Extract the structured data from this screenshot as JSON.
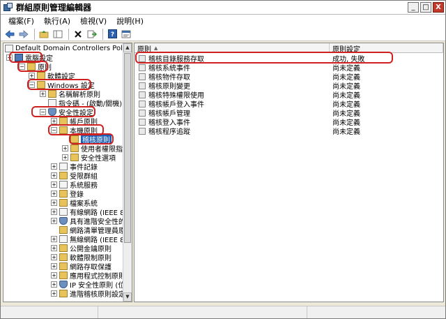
{
  "window": {
    "title": "群組原則管理編輯器"
  },
  "window_buttons": {
    "minimize": "_",
    "maximize": "□",
    "close": "X"
  },
  "menu": [
    {
      "label": "檔案(F)"
    },
    {
      "label": "執行(A)"
    },
    {
      "label": "檢視(V)"
    },
    {
      "label": "說明(H)"
    }
  ],
  "toolbar_icons": [
    "back-arrow-icon",
    "forward-arrow-icon",
    "up-folder-icon",
    "show-hide-tree-icon",
    "delete-icon",
    "export-icon",
    "help-icon",
    "properties-icon"
  ],
  "tree": {
    "root": "Default Domain Controllers Policy [SER",
    "items": [
      {
        "label": "電腦設定",
        "icon": "computer"
      },
      {
        "label": "原則",
        "icon": "folder"
      },
      {
        "label": "軟體設定",
        "icon": "folder"
      },
      {
        "label": "Windows 設定",
        "icon": "folder"
      },
      {
        "label": "名稱解析原則",
        "icon": "folder"
      },
      {
        "label": "指令碼 - (啟動/關機)",
        "icon": "doc"
      },
      {
        "label": "安全性設定",
        "icon": "shield"
      },
      {
        "label": "帳戶原則",
        "icon": "folder"
      },
      {
        "label": "本機原則",
        "icon": "folder"
      },
      {
        "label": "稽核原則",
        "icon": "folder"
      },
      {
        "label": "使用者權限指派",
        "icon": "folder"
      },
      {
        "label": "安全性選項",
        "icon": "folder"
      },
      {
        "label": "事件記錄",
        "icon": "doc"
      },
      {
        "label": "受限群組",
        "icon": "folder"
      },
      {
        "label": "系統服務",
        "icon": "doc"
      },
      {
        "label": "登錄",
        "icon": "folder"
      },
      {
        "label": "檔案系統",
        "icon": "folder"
      },
      {
        "label": "有線網路 (IEEE 80",
        "icon": "doc"
      },
      {
        "label": "具有進階安全性的",
        "icon": "shield"
      },
      {
        "label": "網路清單管理員原",
        "icon": "folder"
      },
      {
        "label": "無線網路 (IEEE 80",
        "icon": "doc"
      },
      {
        "label": "公開金鑰原則",
        "icon": "folder"
      },
      {
        "label": "軟體限制原則",
        "icon": "folder"
      },
      {
        "label": "網路存取保護",
        "icon": "folder"
      },
      {
        "label": "應用程式控制原則",
        "icon": "folder"
      },
      {
        "label": "IP 安全性原則 (位",
        "icon": "shield"
      },
      {
        "label": "進階稽核原則設定",
        "icon": "folder"
      }
    ]
  },
  "list": {
    "columns": [
      "原則",
      "原則設定"
    ],
    "rows": [
      {
        "policy": "稽核目錄服務存取",
        "setting": "成功, 失敗"
      },
      {
        "policy": "稽核系統事件",
        "setting": "尚未定義"
      },
      {
        "policy": "稽核物件存取",
        "setting": "尚未定義"
      },
      {
        "policy": "稽核原則變更",
        "setting": "尚未定義"
      },
      {
        "policy": "稽核特殊權限使用",
        "setting": "尚未定義"
      },
      {
        "policy": "稽核帳戶登入事件",
        "setting": "尚未定義"
      },
      {
        "policy": "稽核帳戶管理",
        "setting": "尚未定義"
      },
      {
        "policy": "稽核登入事件",
        "setting": "尚未定義"
      },
      {
        "policy": "稽核程序追蹤",
        "setting": "尚未定義"
      }
    ]
  },
  "colors": {
    "highlight": "#d12020",
    "selection": "#1c5fb4"
  }
}
